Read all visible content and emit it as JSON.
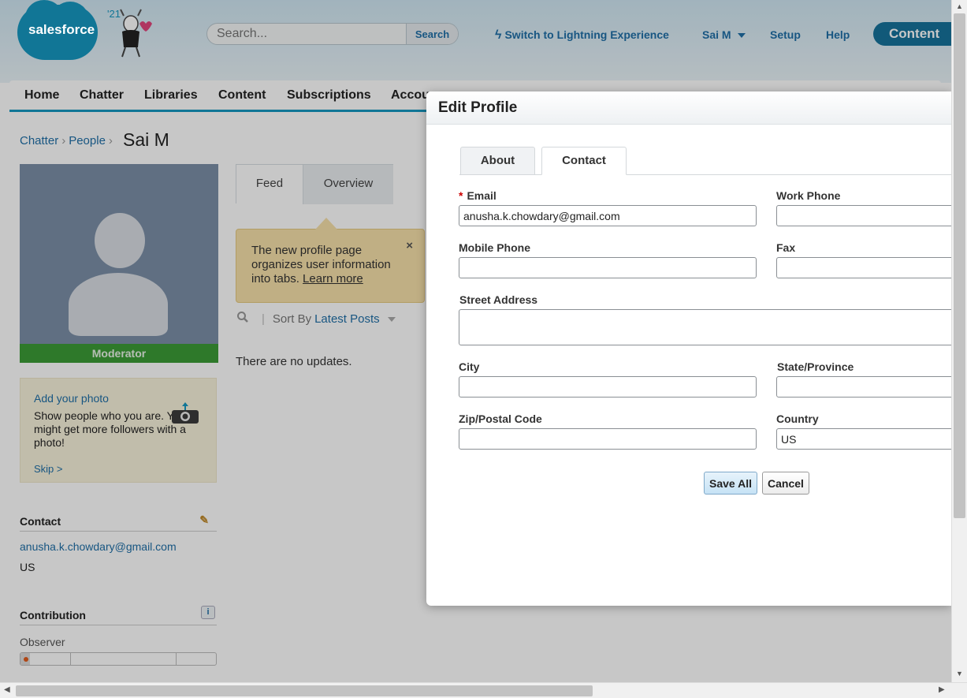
{
  "header": {
    "logo_text": "salesforce",
    "mascot_year": "'21",
    "search_placeholder": "Search...",
    "search_button": "Search",
    "switch_lightning": "Switch to Lightning Experience",
    "user_menu": "Sai M",
    "setup": "Setup",
    "help": "Help",
    "app_label": "Content"
  },
  "nav": {
    "items": [
      "Home",
      "Chatter",
      "Libraries",
      "Content",
      "Subscriptions",
      "Accou"
    ]
  },
  "breadcrumb": {
    "items": [
      "Chatter",
      "People"
    ],
    "current": "Sai M"
  },
  "profile": {
    "role_badge": "Moderator",
    "photo_card": {
      "title": "Add your photo",
      "text": "Show people who you are. You might get more followers with a photo!",
      "skip": "Skip >"
    },
    "contact": {
      "heading": "Contact",
      "email": "anusha.k.chowdary@gmail.com",
      "country": "US"
    },
    "contribution": {
      "heading": "Contribution",
      "info": "i",
      "level": "Observer",
      "progress": 0.05
    }
  },
  "feed": {
    "tabs": [
      "Feed",
      "Overview"
    ],
    "tooltip": {
      "text": "The new profile page organizes user information into tabs.",
      "link": "Learn more",
      "close": "×"
    },
    "sort_label": "Sort By",
    "sort_value": "Latest Posts",
    "empty": "There are no updates."
  },
  "modal": {
    "title": "Edit Profile",
    "tabs": [
      "About",
      "Contact"
    ],
    "fields": {
      "email_label": "Email",
      "email_value": "anusha.k.chowdary@gmail.com",
      "work_phone_label": "Work Phone",
      "work_phone_value": "",
      "mobile_phone_label": "Mobile Phone",
      "mobile_phone_value": "",
      "fax_label": "Fax",
      "fax_value": "",
      "street_label": "Street Address",
      "street_value": "",
      "city_label": "City",
      "city_value": "",
      "state_label": "State/Province",
      "state_value": "",
      "zip_label": "Zip/Postal Code",
      "zip_value": "",
      "country_label": "Country",
      "country_value": "US",
      "required_mark": "*"
    },
    "save_label": "Save All",
    "cancel_label": "Cancel"
  },
  "colors": {
    "brand_blue": "#1798c1",
    "link_blue": "#1f6fa7",
    "moderator_green": "#3c9b36",
    "tooltip_yellow": "#f6e0a9"
  }
}
